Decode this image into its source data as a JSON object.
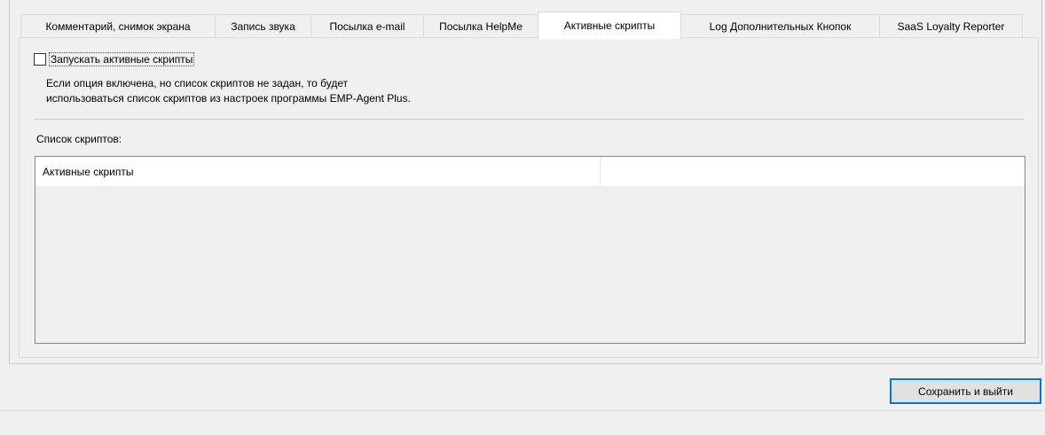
{
  "tabs": [
    {
      "label": "Комментарий, снимок экрана"
    },
    {
      "label": "Запись звука"
    },
    {
      "label": "Посылка e-mail"
    },
    {
      "label": "Посылка HelpMe"
    },
    {
      "label": "Активные скрипты",
      "active": true
    },
    {
      "label": "Log Дополнительных Кнопок"
    },
    {
      "label": "SaaS Loyalty Reporter"
    }
  ],
  "options": {
    "run_active_scripts_label": "Запускать активные скрипты",
    "run_active_scripts_checked": false,
    "description_line1": "Если опция включена, но список скриптов не задан, то будет",
    "description_line2": "использоваться список скриптов из настроек программы EMP-Agent Plus."
  },
  "scripts_list": {
    "label": "Список скриптов:",
    "columns": [
      "Активные скрипты",
      ""
    ]
  },
  "footer": {
    "save_exit_label": "Сохранить и выйти"
  },
  "colors": {
    "background": "#f0f0f0",
    "accent": "#0078d7"
  }
}
